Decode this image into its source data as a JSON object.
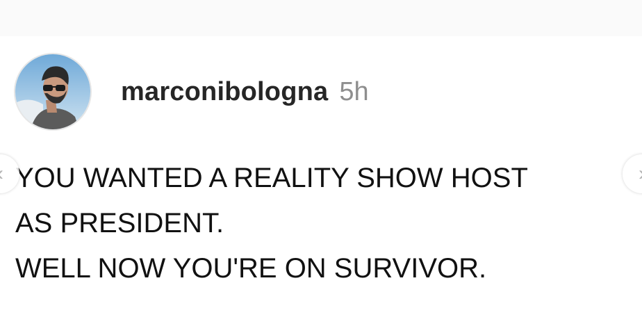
{
  "post": {
    "username": "marconibologna",
    "timestamp": "5h",
    "caption_lines": [
      "YOU WANTED A REALITY SHOW HOST",
      "AS PRESIDENT.",
      "WELL NOW YOU'RE ON SURVIVOR."
    ],
    "avatar_icon": "profile-photo",
    "prev_icon": "chevron-left-icon",
    "next_icon": "chevron-right-icon"
  },
  "colors": {
    "username": "#262626",
    "timestamp": "#8e8e8e",
    "caption": "#111111",
    "background": "#ffffff"
  }
}
